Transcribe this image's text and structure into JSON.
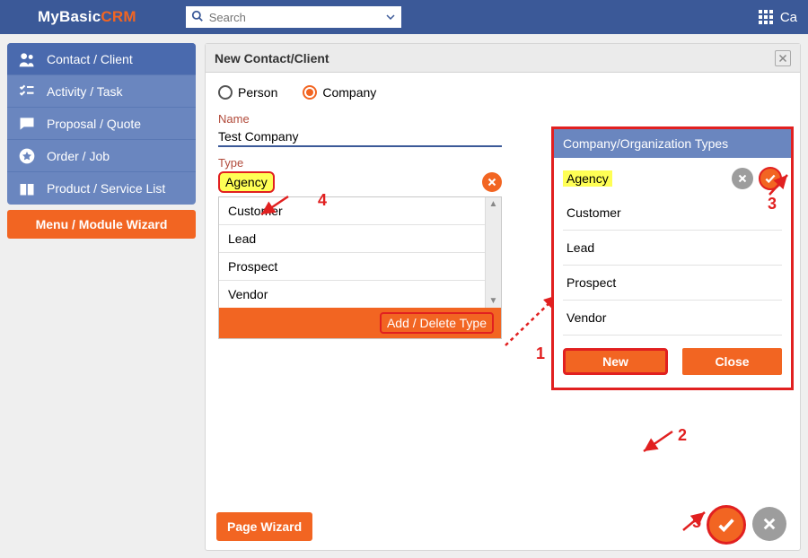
{
  "brand": {
    "part1": "MyBasic",
    "part2": "CRM"
  },
  "search": {
    "placeholder": "Search"
  },
  "topbar": {
    "right_truncated": "Ca"
  },
  "sidebar": {
    "items": [
      {
        "label": "Contact / Client",
        "icon": "users-icon"
      },
      {
        "label": "Activity / Task",
        "icon": "checklist-icon"
      },
      {
        "label": "Proposal / Quote",
        "icon": "chat-icon"
      },
      {
        "label": "Order / Job",
        "icon": "star-circle-icon"
      },
      {
        "label": "Product / Service List",
        "icon": "gift-icon"
      }
    ],
    "wizard": "Menu / Module Wizard"
  },
  "form": {
    "title": "New Contact/Client",
    "radio_person": "Person",
    "radio_company": "Company",
    "name_label": "Name",
    "name_value": "Test Company",
    "type_label": "Type",
    "type_value": "Agency",
    "dropdown": [
      "Customer",
      "Lead",
      "Prospect",
      "Vendor"
    ],
    "add_delete_type": "Add / Delete Type",
    "page_wizard": "Page Wizard"
  },
  "types_popup": {
    "title": "Company/Organization Types",
    "input_value": "Agency",
    "items": [
      "Customer",
      "Lead",
      "Prospect",
      "Vendor"
    ],
    "btn_new": "New",
    "btn_close": "Close"
  },
  "annotations": {
    "n1": "1",
    "n2": "2",
    "n3": "3",
    "n4": "4",
    "n5": "5"
  }
}
